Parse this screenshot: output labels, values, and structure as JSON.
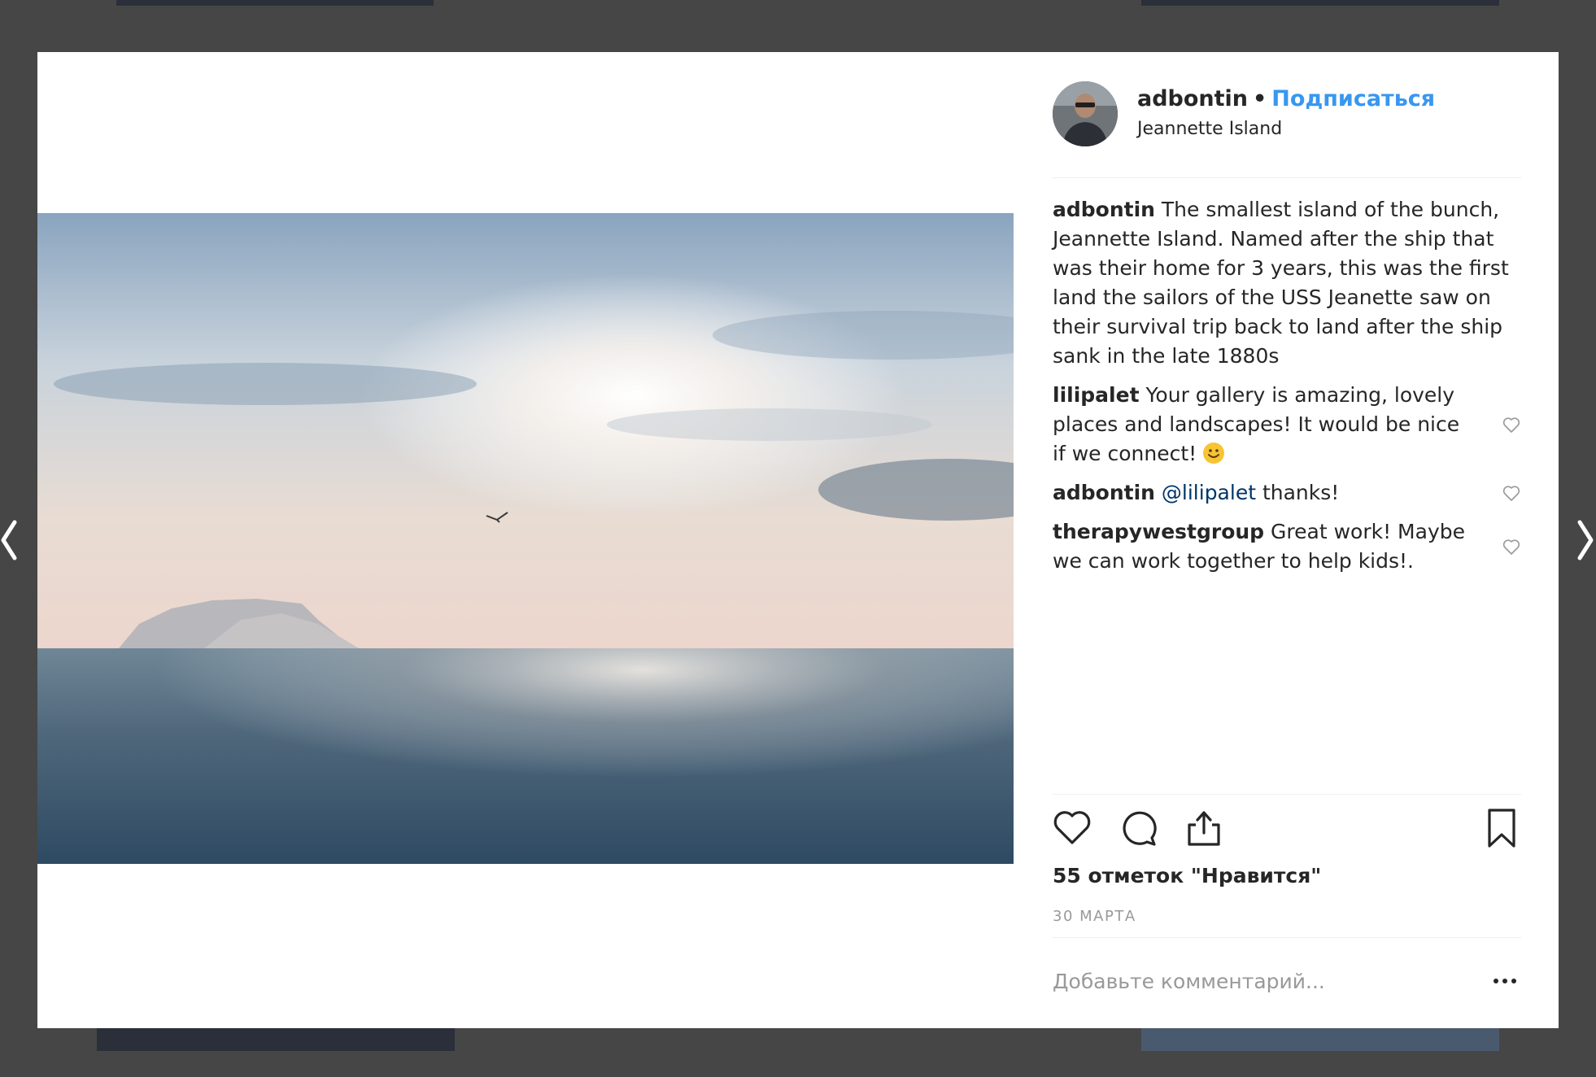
{
  "post": {
    "username": "adbontin",
    "separator": "•",
    "follow_label": "Подписаться",
    "location": "Jeannette Island"
  },
  "caption": {
    "username": "adbontin",
    "text": "The smallest island of the bunch, Jeannette Island. Named after the ship that was their home for 3 years, this was the first land the sailors of the USS Jeanette saw on their survival trip back to land after the ship sank in the late 1880s"
  },
  "comments": [
    {
      "username": "lilipalet",
      "text": "Your gallery is amazing, lovely places and landscapes! It would be nice if we connect!"
    },
    {
      "username": "adbontin",
      "mention": "@lilipalet",
      "text": "thanks!"
    },
    {
      "username": "therapywestgroup",
      "text": "Great work! Maybe we can work together to help kids!."
    }
  ],
  "likes_label": "55 отметок \"Нравится\"",
  "date_label": "30 МАРТА",
  "add_comment": {
    "placeholder": "Добавьте комментарий..."
  },
  "icons": {
    "like": "heart-icon",
    "comment": "comment-bubble-icon",
    "share": "share-icon",
    "save": "bookmark-icon",
    "more": "more-dots-icon",
    "prev": "chevron-left-icon",
    "next": "chevron-right-icon"
  },
  "colors": {
    "follow": "#3897f0",
    "mention": "#003569",
    "muted": "#999999",
    "text": "#262626",
    "backdrop": "#464646"
  }
}
